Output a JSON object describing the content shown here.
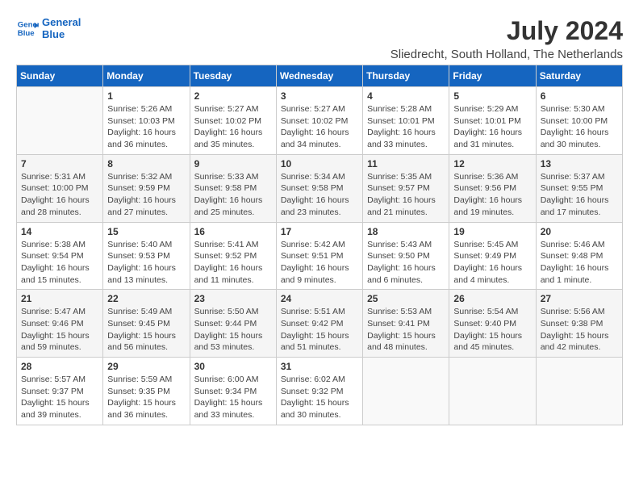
{
  "logo": {
    "line1": "General",
    "line2": "Blue"
  },
  "title": "July 2024",
  "location": "Sliedrecht, South Holland, The Netherlands",
  "days_header": [
    "Sunday",
    "Monday",
    "Tuesday",
    "Wednesday",
    "Thursday",
    "Friday",
    "Saturday"
  ],
  "weeks": [
    [
      {
        "day": "",
        "info": ""
      },
      {
        "day": "1",
        "info": "Sunrise: 5:26 AM\nSunset: 10:03 PM\nDaylight: 16 hours\nand 36 minutes."
      },
      {
        "day": "2",
        "info": "Sunrise: 5:27 AM\nSunset: 10:02 PM\nDaylight: 16 hours\nand 35 minutes."
      },
      {
        "day": "3",
        "info": "Sunrise: 5:27 AM\nSunset: 10:02 PM\nDaylight: 16 hours\nand 34 minutes."
      },
      {
        "day": "4",
        "info": "Sunrise: 5:28 AM\nSunset: 10:01 PM\nDaylight: 16 hours\nand 33 minutes."
      },
      {
        "day": "5",
        "info": "Sunrise: 5:29 AM\nSunset: 10:01 PM\nDaylight: 16 hours\nand 31 minutes."
      },
      {
        "day": "6",
        "info": "Sunrise: 5:30 AM\nSunset: 10:00 PM\nDaylight: 16 hours\nand 30 minutes."
      }
    ],
    [
      {
        "day": "7",
        "info": "Sunrise: 5:31 AM\nSunset: 10:00 PM\nDaylight: 16 hours\nand 28 minutes."
      },
      {
        "day": "8",
        "info": "Sunrise: 5:32 AM\nSunset: 9:59 PM\nDaylight: 16 hours\nand 27 minutes."
      },
      {
        "day": "9",
        "info": "Sunrise: 5:33 AM\nSunset: 9:58 PM\nDaylight: 16 hours\nand 25 minutes."
      },
      {
        "day": "10",
        "info": "Sunrise: 5:34 AM\nSunset: 9:58 PM\nDaylight: 16 hours\nand 23 minutes."
      },
      {
        "day": "11",
        "info": "Sunrise: 5:35 AM\nSunset: 9:57 PM\nDaylight: 16 hours\nand 21 minutes."
      },
      {
        "day": "12",
        "info": "Sunrise: 5:36 AM\nSunset: 9:56 PM\nDaylight: 16 hours\nand 19 minutes."
      },
      {
        "day": "13",
        "info": "Sunrise: 5:37 AM\nSunset: 9:55 PM\nDaylight: 16 hours\nand 17 minutes."
      }
    ],
    [
      {
        "day": "14",
        "info": "Sunrise: 5:38 AM\nSunset: 9:54 PM\nDaylight: 16 hours\nand 15 minutes."
      },
      {
        "day": "15",
        "info": "Sunrise: 5:40 AM\nSunset: 9:53 PM\nDaylight: 16 hours\nand 13 minutes."
      },
      {
        "day": "16",
        "info": "Sunrise: 5:41 AM\nSunset: 9:52 PM\nDaylight: 16 hours\nand 11 minutes."
      },
      {
        "day": "17",
        "info": "Sunrise: 5:42 AM\nSunset: 9:51 PM\nDaylight: 16 hours\nand 9 minutes."
      },
      {
        "day": "18",
        "info": "Sunrise: 5:43 AM\nSunset: 9:50 PM\nDaylight: 16 hours\nand 6 minutes."
      },
      {
        "day": "19",
        "info": "Sunrise: 5:45 AM\nSunset: 9:49 PM\nDaylight: 16 hours\nand 4 minutes."
      },
      {
        "day": "20",
        "info": "Sunrise: 5:46 AM\nSunset: 9:48 PM\nDaylight: 16 hours\nand 1 minute."
      }
    ],
    [
      {
        "day": "21",
        "info": "Sunrise: 5:47 AM\nSunset: 9:46 PM\nDaylight: 15 hours\nand 59 minutes."
      },
      {
        "day": "22",
        "info": "Sunrise: 5:49 AM\nSunset: 9:45 PM\nDaylight: 15 hours\nand 56 minutes."
      },
      {
        "day": "23",
        "info": "Sunrise: 5:50 AM\nSunset: 9:44 PM\nDaylight: 15 hours\nand 53 minutes."
      },
      {
        "day": "24",
        "info": "Sunrise: 5:51 AM\nSunset: 9:42 PM\nDaylight: 15 hours\nand 51 minutes."
      },
      {
        "day": "25",
        "info": "Sunrise: 5:53 AM\nSunset: 9:41 PM\nDaylight: 15 hours\nand 48 minutes."
      },
      {
        "day": "26",
        "info": "Sunrise: 5:54 AM\nSunset: 9:40 PM\nDaylight: 15 hours\nand 45 minutes."
      },
      {
        "day": "27",
        "info": "Sunrise: 5:56 AM\nSunset: 9:38 PM\nDaylight: 15 hours\nand 42 minutes."
      }
    ],
    [
      {
        "day": "28",
        "info": "Sunrise: 5:57 AM\nSunset: 9:37 PM\nDaylight: 15 hours\nand 39 minutes."
      },
      {
        "day": "29",
        "info": "Sunrise: 5:59 AM\nSunset: 9:35 PM\nDaylight: 15 hours\nand 36 minutes."
      },
      {
        "day": "30",
        "info": "Sunrise: 6:00 AM\nSunset: 9:34 PM\nDaylight: 15 hours\nand 33 minutes."
      },
      {
        "day": "31",
        "info": "Sunrise: 6:02 AM\nSunset: 9:32 PM\nDaylight: 15 hours\nand 30 minutes."
      },
      {
        "day": "",
        "info": ""
      },
      {
        "day": "",
        "info": ""
      },
      {
        "day": "",
        "info": ""
      }
    ]
  ]
}
